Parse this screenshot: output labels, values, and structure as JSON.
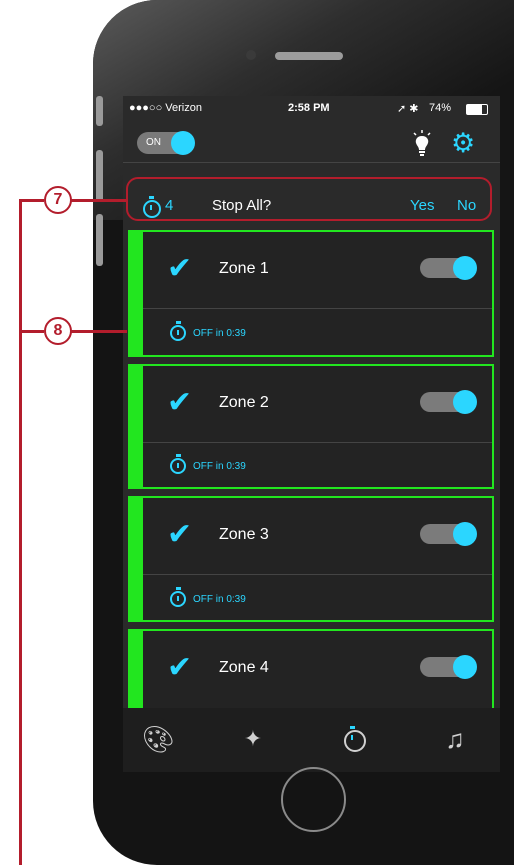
{
  "status_bar": {
    "carrier": "●●●○○ Verizon",
    "time": "2:58 PM",
    "battery": "74%",
    "indicators": "➚ ✱"
  },
  "top_bar": {
    "power_toggle_label": "ON",
    "power_toggle_on": true
  },
  "stop_all": {
    "count": "4",
    "prompt": "Stop All?",
    "yes_label": "Yes",
    "no_label": "No"
  },
  "zones": [
    {
      "name": "Zone 1",
      "timer_text": "OFF in 0:39",
      "checked": true,
      "on": true
    },
    {
      "name": "Zone 2",
      "timer_text": "OFF in 0:39",
      "checked": true,
      "on": true
    },
    {
      "name": "Zone 3",
      "timer_text": "OFF in 0:39",
      "checked": true,
      "on": true
    },
    {
      "name": "Zone 4",
      "checked": true,
      "on": true
    }
  ],
  "tab_bar": {
    "icons": [
      "palette-icon",
      "sparkles-icon",
      "timer-icon",
      "music-icon"
    ]
  },
  "callouts": {
    "seven": "7",
    "eight": "8"
  },
  "colors": {
    "accent_cyan": "#2bd6ff",
    "zone_green": "#22e61f",
    "callout_red": "#b31d2c",
    "screen_bg": "#2a2a2a"
  }
}
